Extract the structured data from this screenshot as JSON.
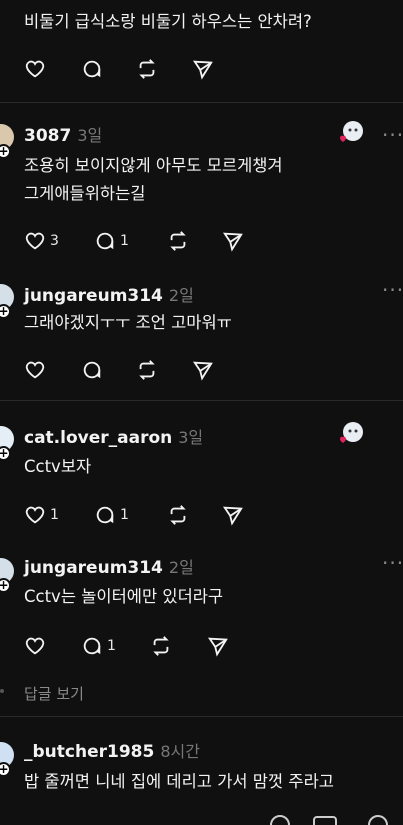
{
  "comments": [
    {
      "username": "",
      "time": "",
      "text_lines": [
        "비둘기 급식소랑 비둘기 하우스는 안차려?"
      ],
      "likes": "",
      "replies": ""
    },
    {
      "username": "3087",
      "time": "3일",
      "text_lines": [
        "조용히 보이지않게 아무도 모르게챙겨",
        "그게애들위하는길"
      ],
      "likes": "3",
      "replies": "1"
    },
    {
      "username": "jungareum314",
      "time": "2일",
      "text_lines": [
        "그래야겠지ㅜㅜ 조언 고마워ㅠ"
      ],
      "likes": "",
      "replies": ""
    },
    {
      "username": "cat.lover_aaron",
      "time": "3일",
      "text_lines": [
        "Cctv보자"
      ],
      "likes": "1",
      "replies": "1"
    },
    {
      "username": "jungareum314",
      "time": "2일",
      "text_lines": [
        "Cctv는 놀이터에만 있더라구"
      ],
      "likes": "",
      "replies": "1"
    },
    {
      "username": "_butcher1985",
      "time": "8시간",
      "text_lines": [
        "밥 줄꺼면 니네 집에 데리고 가서 맘껏 주라고"
      ],
      "likes": "",
      "replies": ""
    }
  ],
  "view_replies_label": "답글 보기",
  "icons": {
    "like": "heart-icon",
    "reply": "comment-icon",
    "repost": "repost-icon",
    "share": "send-icon",
    "more": "more-dots-icon"
  },
  "colors": {
    "background": "#101010",
    "text": "#f3f3f3",
    "muted": "#777777",
    "liked_heart": "#e0245e"
  }
}
